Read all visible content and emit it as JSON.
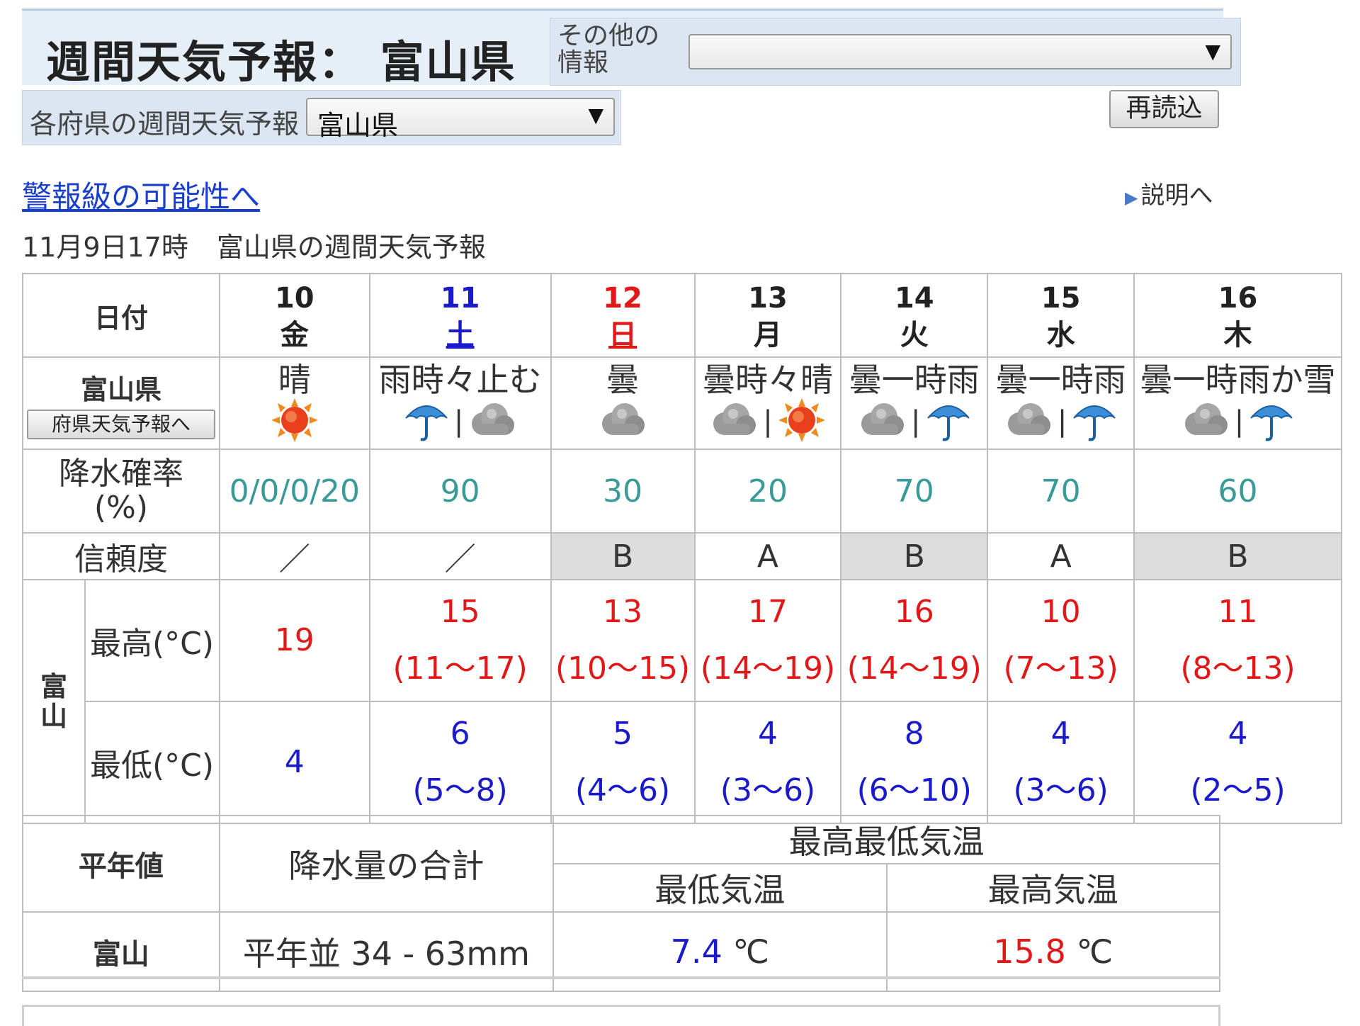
{
  "header": {
    "title": "週間天気予報： 富山県",
    "other_info_label": "その他の情報",
    "other_info_value": "",
    "pref_label": "各府県の週間天気予報",
    "pref_value": "富山県",
    "reload_label": "再読込"
  },
  "links": {
    "warning": "警報級の可能性へ",
    "explain": "説明へ"
  },
  "issued": {
    "time": "11月9日17時",
    "text": "富山県の週間天気予報"
  },
  "table": {
    "date_header": "日付",
    "region_label": "富山県",
    "pref_forecast_button": "府県天気予報へ",
    "pop_label": "降水確率",
    "pop_unit": "(%)",
    "reliability_label": "信頼度",
    "station_label": "富山",
    "max_label": "最高(°C)",
    "min_label": "最低(°C)",
    "days": [
      {
        "date": "10",
        "dow": "金",
        "weather": "晴",
        "pop": "0/0/0/20",
        "rel": "／",
        "max": "19",
        "max_range": "",
        "min": "4",
        "min_range": ""
      },
      {
        "date": "11",
        "dow": "土",
        "weather": "雨時々止む",
        "pop": "90",
        "rel": "／",
        "max": "15",
        "max_range": "(11～17)",
        "min": "6",
        "min_range": "(5～8)"
      },
      {
        "date": "12",
        "dow": "日",
        "weather": "曇",
        "pop": "30",
        "rel": "B",
        "max": "13",
        "max_range": "(10～15)",
        "min": "5",
        "min_range": "(4～6)"
      },
      {
        "date": "13",
        "dow": "月",
        "weather": "曇時々晴",
        "pop": "20",
        "rel": "A",
        "max": "17",
        "max_range": "(14～19)",
        "min": "4",
        "min_range": "(3～6)"
      },
      {
        "date": "14",
        "dow": "火",
        "weather": "曇一時雨",
        "pop": "70",
        "rel": "B",
        "max": "16",
        "max_range": "(14～19)",
        "min": "8",
        "min_range": "(6～10)"
      },
      {
        "date": "15",
        "dow": "水",
        "weather": "曇一時雨",
        "pop": "70",
        "rel": "A",
        "max": "10",
        "max_range": "(7～13)",
        "min": "4",
        "min_range": "(3～6)"
      },
      {
        "date": "16",
        "dow": "木",
        "weather": "曇一時雨か雪",
        "pop": "60",
        "rel": "B",
        "max": "11",
        "max_range": "(8～13)",
        "min": "4",
        "min_range": "(2～5)"
      }
    ]
  },
  "normals": {
    "header": "平年値",
    "precip_header": "降水量の合計",
    "temp_header": "最高最低気温",
    "min_temp_header": "最低気温",
    "max_temp_header": "最高気温",
    "station": "富山",
    "precip_value": "平年並 34 - 63mm",
    "min_temp_value": "7.4",
    "max_temp_value": "15.8",
    "temp_unit": "℃"
  },
  "icons": {
    "sun": "sun-icon",
    "cloud": "cloud-icon",
    "umbrella": "umbrella-icon"
  },
  "colors": {
    "saturday": "#1a1acc",
    "sunday": "#e01818",
    "max_temp": "#e01818",
    "min_temp": "#1a1acc",
    "pop": "#3a9a96",
    "link": "#1a3fcc"
  }
}
